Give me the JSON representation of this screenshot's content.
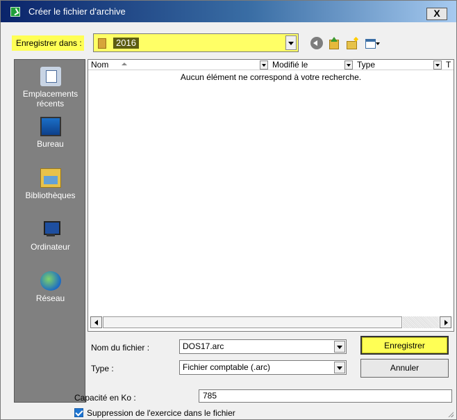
{
  "window": {
    "title": "Créer le fichier d'archive",
    "close_label": "X"
  },
  "save_in": {
    "label": "Enregistrer dans :",
    "value": "2016"
  },
  "toolbar": {
    "icons": [
      "back-icon",
      "up-folder-icon",
      "new-folder-icon",
      "views-menu-icon"
    ]
  },
  "places": [
    {
      "label": "Emplacements récents",
      "icon": "recent-places-icon"
    },
    {
      "label": "Bureau",
      "icon": "desktop-icon"
    },
    {
      "label": "Bibliothèques",
      "icon": "libraries-icon"
    },
    {
      "label": "Ordinateur",
      "icon": "computer-icon"
    },
    {
      "label": "Réseau",
      "icon": "network-icon"
    }
  ],
  "file_list": {
    "columns": [
      "Nom",
      "Modifié le",
      "Type",
      "T"
    ],
    "empty_message": "Aucun élément ne correspond à votre recherche."
  },
  "filename": {
    "label": "Nom du fichier :",
    "value": "DOS17.arc"
  },
  "filetype": {
    "label": "Type :",
    "value": "Fichier comptable (.arc)"
  },
  "buttons": {
    "save": "Enregistrer",
    "cancel": "Annuler"
  },
  "capacity": {
    "label": "Capacité en Ko :",
    "value": "785"
  },
  "delete_option": {
    "label": "Suppression de l'exercice dans le fichier",
    "checked": true
  },
  "colors": {
    "highlight": "#ffff55",
    "titlebar": "#0a246a",
    "places_bg": "#808080"
  }
}
